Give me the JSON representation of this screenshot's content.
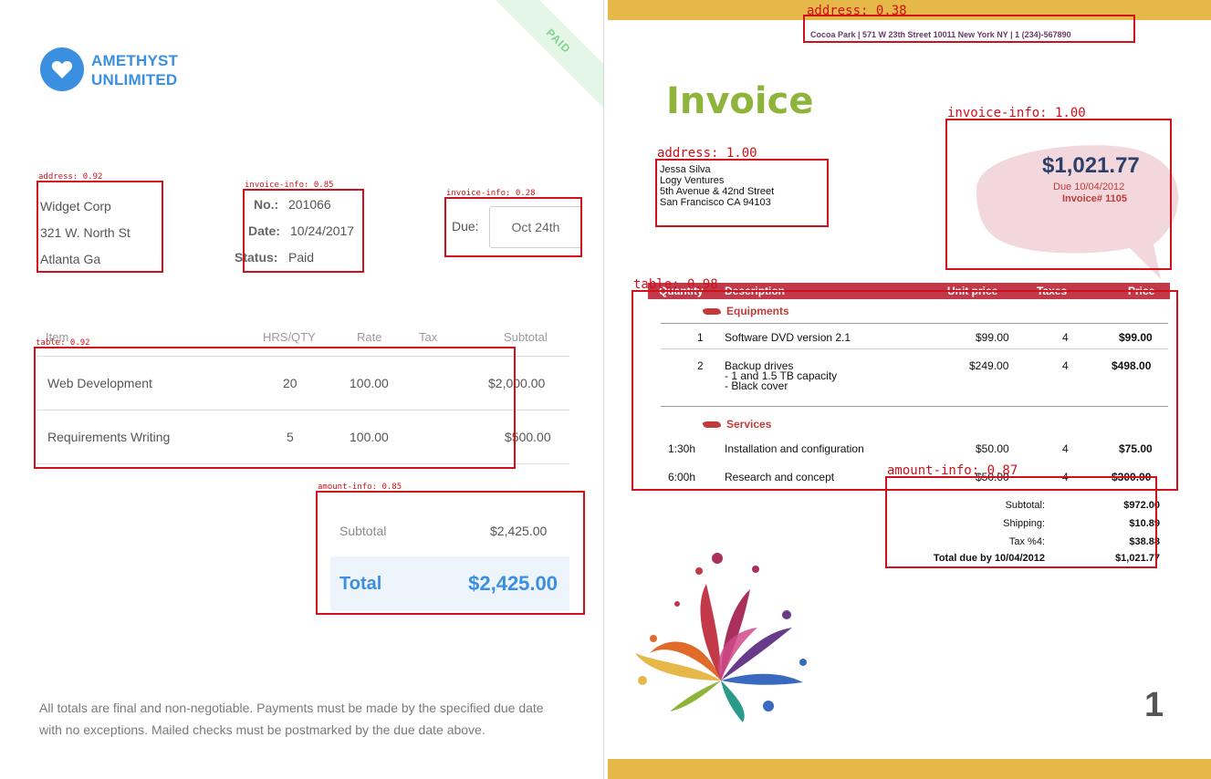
{
  "left_invoice": {
    "badge": "PAID",
    "logo": {
      "line1": "AMETHYST",
      "line2": "UNLIMITED",
      "icon": "heart-icon",
      "color": "#3b8fe0"
    },
    "address": {
      "line1": "Widget Corp",
      "line2": "321 W. North St",
      "line3": "Atlanta Ga"
    },
    "invoice_info": {
      "number_label": "No.:",
      "number_value": "201066",
      "date_label": "Date:",
      "date_value": "10/24/2017",
      "status_label": "Status:",
      "status_value": "Paid"
    },
    "due": {
      "label": "Due:",
      "value": "Oct 24th"
    },
    "table": {
      "headers": {
        "item": "Item",
        "qty": "HRS/QTY",
        "rate": "Rate",
        "tax": "Tax",
        "subtotal": "Subtotal"
      },
      "rows": [
        {
          "item": "Web Development",
          "qty": "20",
          "rate": "100.00",
          "tax": "",
          "subtotal": "$2,000.00"
        },
        {
          "item": "Requirements Writing",
          "qty": "5",
          "rate": "100.00",
          "tax": "",
          "subtotal": "$500.00"
        }
      ]
    },
    "totals": {
      "subtotal_label": "Subtotal",
      "subtotal_value": "$2,425.00",
      "total_label": "Total",
      "total_value": "$2,425.00"
    },
    "footer": "All totals are final and non-negotiable. Payments must be made by the specified due date with no exceptions. Mailed checks must be postmarked by the due date above."
  },
  "right_invoice": {
    "contact_line": "Cocoa Park | 571 W 23th Street 10011 New York NY | 1 (234)-567890",
    "title": "Invoice",
    "address": {
      "line1": "Jessa Silva",
      "line2": "Logy Ventures",
      "line3": "5th Avenue & 42nd Street",
      "line4": "San Francisco CA 94103"
    },
    "invoice_info": {
      "amount": "$1,021.77",
      "due": "Due 10/04/2012",
      "number": "Invoice# 1105"
    },
    "table": {
      "headers": {
        "qty": "Quantity",
        "desc": "Description",
        "unit": "Unit price",
        "taxes": "Taxes",
        "price": "Price"
      },
      "sections": [
        {
          "name": "Equipments",
          "rows": [
            {
              "qty": "1",
              "desc": "Software DVD version 2.1",
              "desc2": "",
              "desc3": "",
              "unit": "$99.00",
              "taxes": "4",
              "price": "$99.00"
            },
            {
              "qty": "2",
              "desc": "Backup drives",
              "desc2": "- 1 and 1.5 TB capacity",
              "desc3": "- Black cover",
              "unit": "$249.00",
              "taxes": "4",
              "price": "$498.00"
            }
          ]
        },
        {
          "name": "Services",
          "rows": [
            {
              "qty": "1:30h",
              "desc": "Installation and configuration",
              "unit": "$50.00",
              "taxes": "4",
              "price": "$75.00"
            },
            {
              "qty": "6:00h",
              "desc": "Research and concept",
              "unit": "$50.00",
              "taxes": "4",
              "price": "$300.00"
            }
          ]
        }
      ]
    },
    "totals": {
      "subtotal_label": "Subtotal:",
      "subtotal_value": "$972.00",
      "shipping_label": "Shipping:",
      "shipping_value": "$10.89",
      "tax_label": "Tax %4:",
      "tax_value": "$38.88",
      "total_label": "Total due by 10/04/2012",
      "total_value": "$1,021.77"
    },
    "page_number": "1",
    "colors": {
      "bar": "#e6b84a",
      "title": "#8fb43a",
      "accent": "#c23a4a"
    }
  },
  "detections": [
    {
      "label": "address: 0.92"
    },
    {
      "label": "invoice-info: 0.85"
    },
    {
      "label": "invoice-info: 0.28"
    },
    {
      "label": "table: 0.92"
    },
    {
      "label": "amount-info: 0.85"
    },
    {
      "label": "address: 0.38"
    },
    {
      "label": "invoice-info: 1.00"
    },
    {
      "label": "address: 1.00"
    },
    {
      "label": "table: 0.98"
    },
    {
      "label": "amount-info: 0.87"
    }
  ]
}
